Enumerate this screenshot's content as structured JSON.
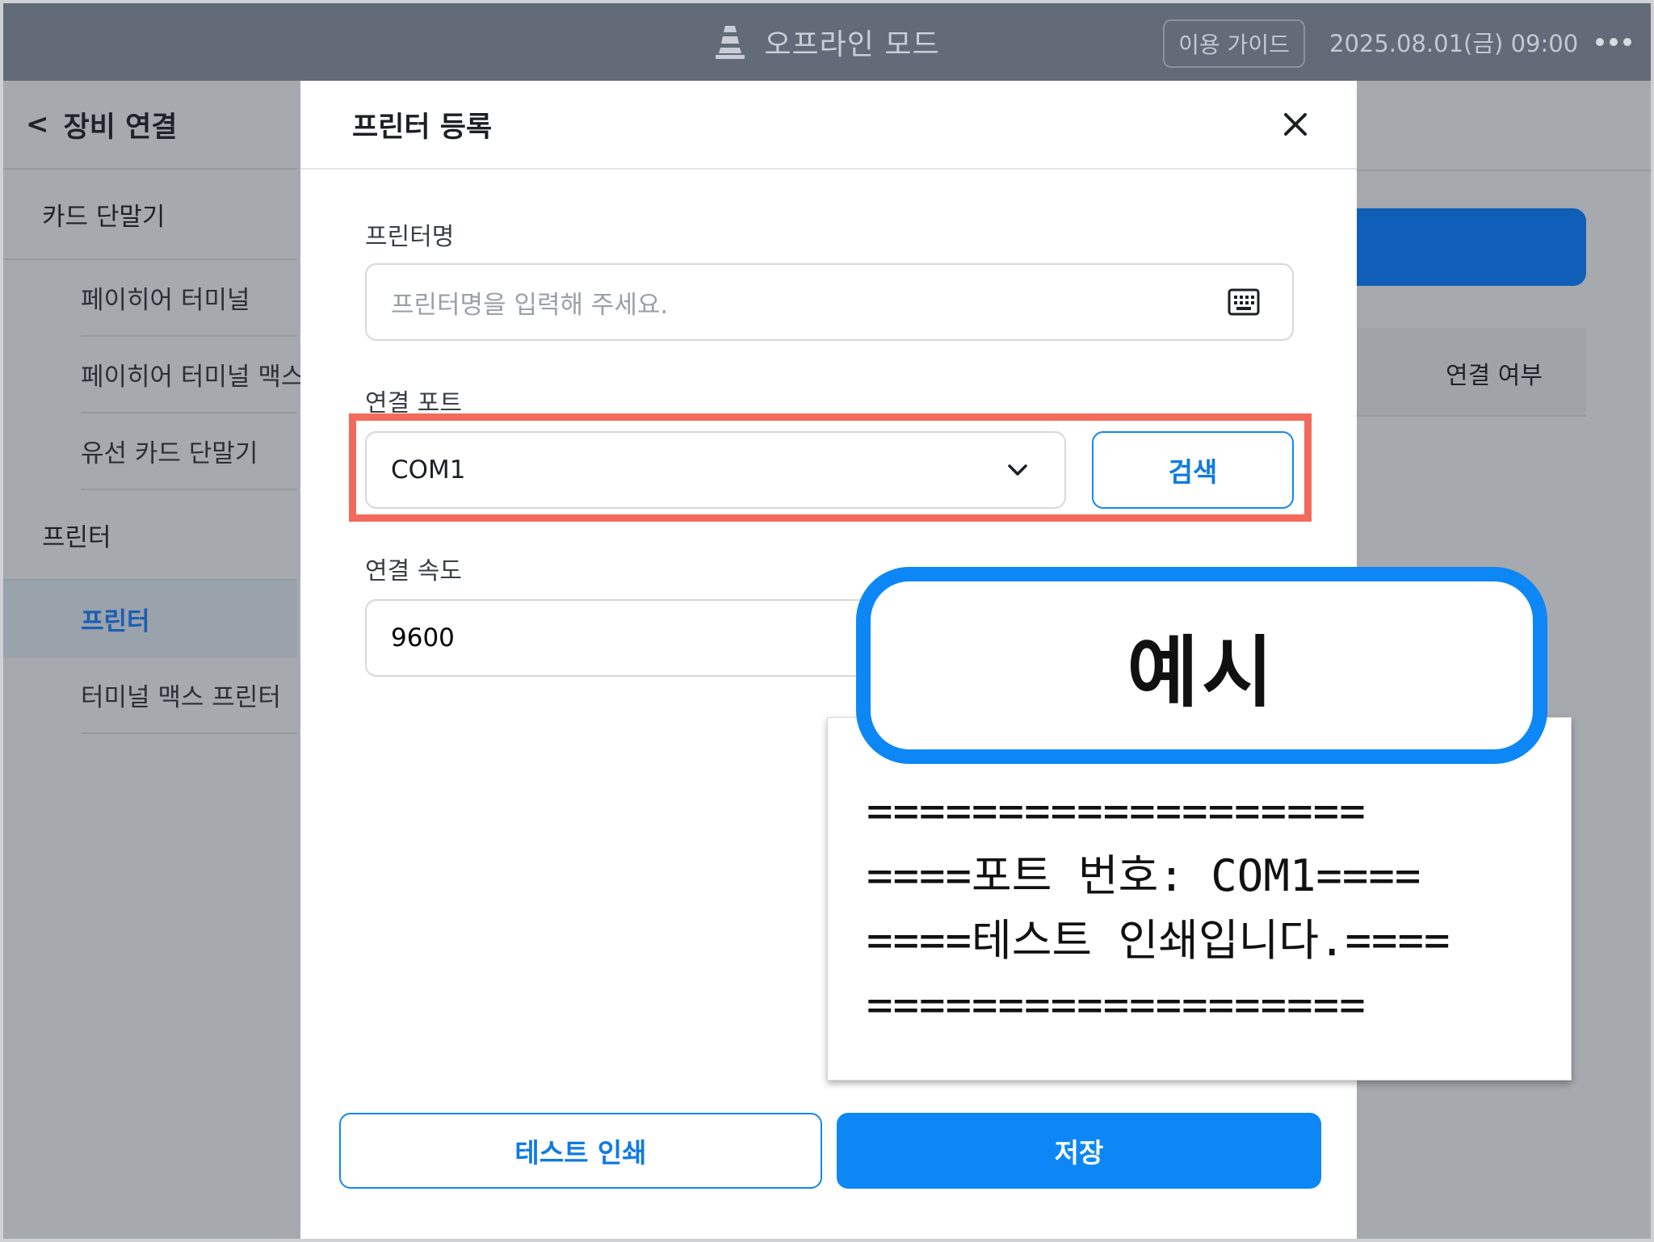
{
  "topbar": {
    "mode_label": "오프라인 모드",
    "guide_label": "이용 가이드",
    "datetime": "2025.08.01(금) 09:00",
    "mode_icon": "traffic-cone-icon",
    "more_icon": "more-dots-icon"
  },
  "sidebar": {
    "title": "장비 연결",
    "back_icon": "chevron-left-icon",
    "card_group": "카드 단말기",
    "card_items": [
      "페이히어 터미널",
      "페이히어 터미널 맥스",
      "유선 카드 단말기"
    ],
    "printer_group": "프린터",
    "printer_items": [
      "프린터",
      "터미널 맥스 프린터"
    ],
    "active_item": "프린터"
  },
  "background": {
    "connection_status_label": "연결 여부"
  },
  "dialog": {
    "title": "프린터 등록",
    "close_icon": "close-icon",
    "printer_name_label": "프린터명",
    "printer_name_placeholder": "프린터명을 입력해 주세요.",
    "printer_name_value": "",
    "keyboard_icon": "keyboard-icon",
    "port_label": "연결 포트",
    "port_value": "COM1",
    "search_label": "검색",
    "speed_label": "연결 속도",
    "speed_value": "9600",
    "test_print_label": "테스트 인쇄",
    "save_label": "저장"
  },
  "example": {
    "badge": "예시",
    "lines": [
      "===================",
      "====포트 번호: COM1====",
      "====테스트 인쇄입니다.====",
      "==================="
    ]
  },
  "colors": {
    "accent": "#0d87f5",
    "highlight": "#f26a5b",
    "topbar": "#626b77"
  }
}
